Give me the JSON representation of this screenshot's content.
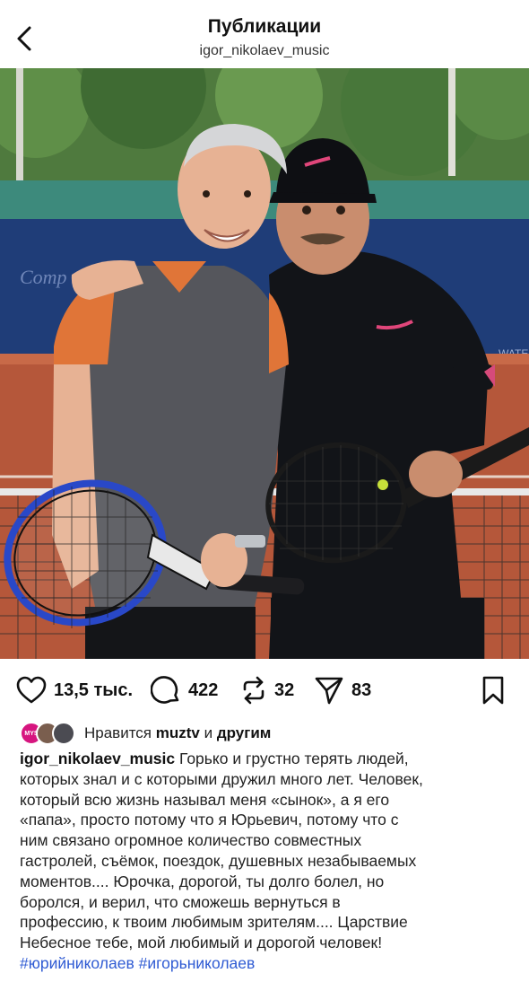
{
  "header": {
    "title": "Публикации",
    "username": "igor_nikolaev_music"
  },
  "post": {
    "likes_count": "13,5 тыс.",
    "comments_count": "422",
    "reposts_count": "32",
    "shares_count": "83",
    "liked_by_prefix": "Нравится",
    "liked_by_user": "muztv",
    "liked_by_and": "и",
    "liked_by_others": "другим",
    "liked_by_avatar_text": "MYS",
    "caption_username": "igor_nikolaev_music",
    "caption_lines": [
      "Горько и грустно терять людей,",
      "которых знал и с которыми дружил много лет. Человек,",
      "который всю жизнь называл меня «сынок», а я его",
      "«папа», просто потому что я Юрьевич, потому что с",
      "ним связано огромное количество совместных",
      "гастролей, съёмок, поездок, душевных незабываемых",
      "моментов.... Юрочка, дорогой, ты долго болел, но",
      "боролся, и верил, что сможешь вернуться в",
      "профессию, к твоим любимым зрителям.... Царствие",
      "Небесное тебе, мой любимый и дорогой человек!"
    ],
    "hashtags": "#юрийниколаев #игорьниколаев"
  },
  "colors": {
    "hashtag": "#2f5bd3",
    "accent_pink": "#d6157f"
  },
  "icons": {
    "back": "chevron-left-icon",
    "like": "heart-icon",
    "comment": "speech-bubble-icon",
    "repost": "repost-icon",
    "share": "send-icon",
    "save": "bookmark-icon"
  }
}
